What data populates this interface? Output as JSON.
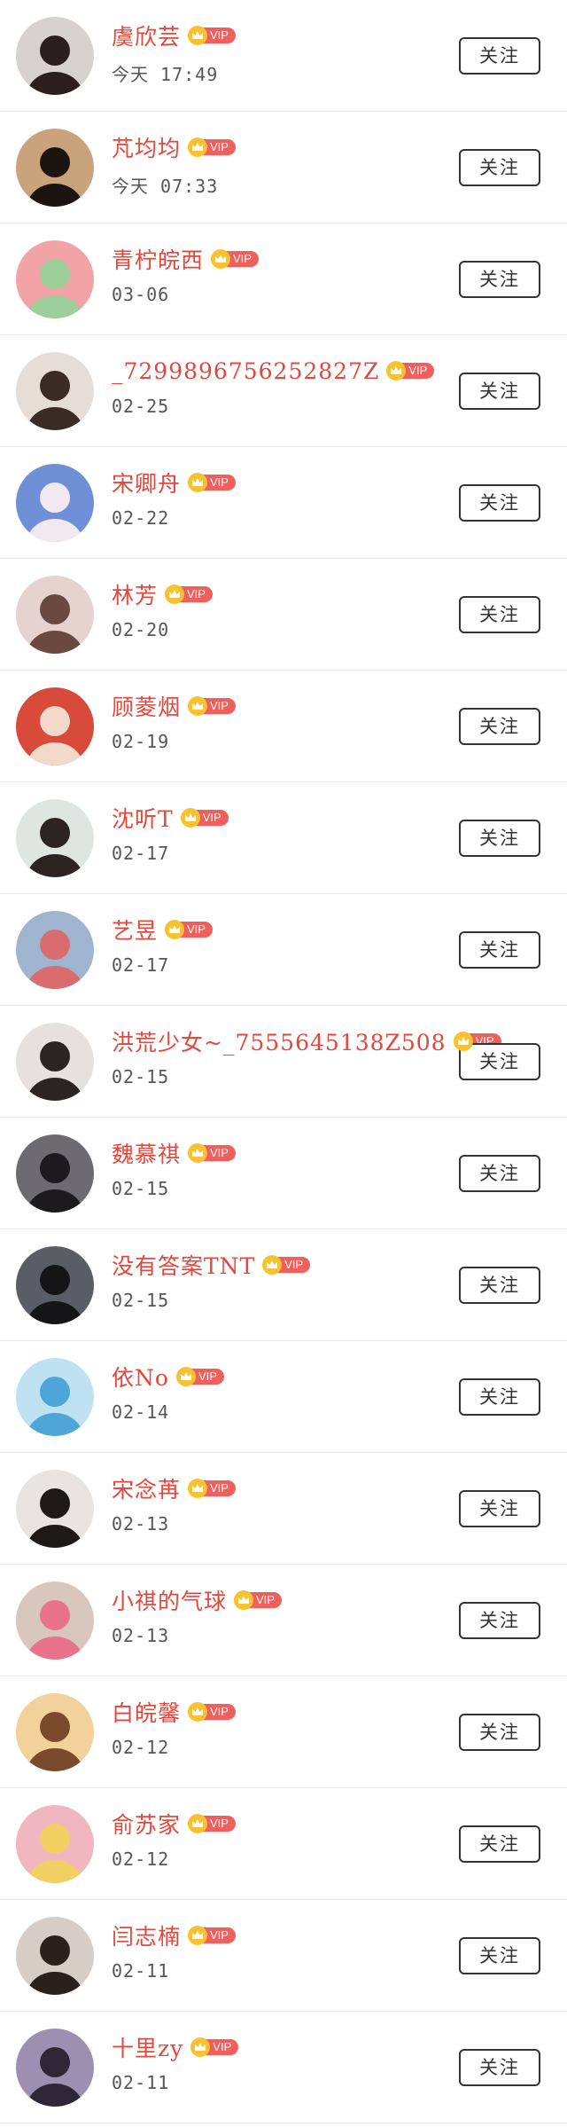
{
  "follow_label": "关注",
  "vip_label": "VIP",
  "colors": {
    "name": "#e0483e",
    "vip_badge": "#ef5f5b",
    "vip_crown": "#f7c12f"
  },
  "users": [
    {
      "name": "虞欣芸",
      "time": "今天 17:49",
      "avatar_colors": [
        "#d8d2cf",
        "#2a1f1c"
      ]
    },
    {
      "name": "芃均均",
      "time": "今天 07:33",
      "avatar_colors": [
        "#c9a37c",
        "#1b1411"
      ]
    },
    {
      "name": "青柠皖西",
      "time": "03-06",
      "avatar_colors": [
        "#f2a3a5",
        "#9ccf9a"
      ]
    },
    {
      "name": "_7299896756252827Z",
      "time": "02-25",
      "avatar_colors": [
        "#e7ddd7",
        "#3a2b26"
      ]
    },
    {
      "name": "宋卿舟",
      "time": "02-22",
      "avatar_colors": [
        "#6f8fd6",
        "#f1e9ef"
      ]
    },
    {
      "name": "林芳",
      "time": "02-20",
      "avatar_colors": [
        "#e6d2cf",
        "#6a4a40"
      ]
    },
    {
      "name": "顾菱烟",
      "time": "02-19",
      "avatar_colors": [
        "#d84a3a",
        "#f3d9c9"
      ]
    },
    {
      "name": "沈听T",
      "time": "02-17",
      "avatar_colors": [
        "#dfe6e1",
        "#2b2420"
      ]
    },
    {
      "name": "艺昱",
      "time": "02-17",
      "avatar_colors": [
        "#9fb5cf",
        "#d96d6d"
      ]
    },
    {
      "name": "洪荒少女~_7555645138Z508",
      "time": "02-15",
      "avatar_colors": [
        "#e6e1dc",
        "#2c2420"
      ]
    },
    {
      "name": "魏慕祺",
      "time": "02-15",
      "avatar_colors": [
        "#6e6b70",
        "#1c1a1d"
      ]
    },
    {
      "name": "没有答案TNT",
      "time": "02-15",
      "avatar_colors": [
        "#5a5d66",
        "#151518"
      ]
    },
    {
      "name": "依No",
      "time": "02-14",
      "avatar_colors": [
        "#bfe2f3",
        "#4ea6d8"
      ]
    },
    {
      "name": "宋念苒",
      "time": "02-13",
      "avatar_colors": [
        "#e9e4e2",
        "#1e1816"
      ]
    },
    {
      "name": "小祺的气球",
      "time": "02-13",
      "avatar_colors": [
        "#d9c6bd",
        "#e8738a"
      ]
    },
    {
      "name": "白皖馨",
      "time": "02-12",
      "avatar_colors": [
        "#f3d19b",
        "#7a4a2c"
      ]
    },
    {
      "name": "俞苏家",
      "time": "02-12",
      "avatar_colors": [
        "#f0b7c0",
        "#f2cf63"
      ]
    },
    {
      "name": "闫志楠",
      "time": "02-11",
      "avatar_colors": [
        "#d6cdc7",
        "#2a201c"
      ]
    },
    {
      "name": "十里zy",
      "time": "02-11",
      "avatar_colors": [
        "#9c8fb2",
        "#2f2737"
      ]
    }
  ]
}
